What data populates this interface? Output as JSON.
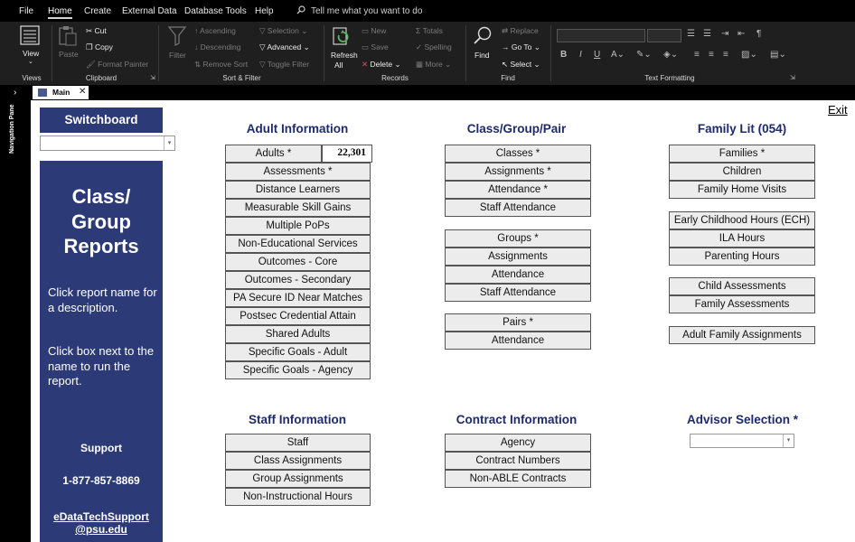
{
  "menu": {
    "tabs": [
      "File",
      "Home",
      "Create",
      "External Data",
      "Database Tools",
      "Help"
    ],
    "active": "Home",
    "tell_me": "Tell me what you want to do"
  },
  "ribbon": {
    "views": {
      "view_label": "View",
      "group_label": "Views"
    },
    "clipboard": {
      "paste_label": "Paste",
      "cut_label": "Cut",
      "copy_label": "Copy",
      "format_painter_label": "Format Painter",
      "group_label": "Clipboard"
    },
    "sort_filter": {
      "filter_label": "Filter",
      "ascending_label": "Ascending",
      "descending_label": "Descending",
      "remove_sort_label": "Remove Sort",
      "selection_label": "Selection",
      "advanced_label": "Advanced",
      "toggle_filter_label": "Toggle Filter",
      "group_label": "Sort & Filter"
    },
    "records": {
      "refresh_label": "Refresh",
      "refresh_all_label": "All",
      "new_label": "New",
      "save_label": "Save",
      "delete_label": "Delete",
      "totals_label": "Totals",
      "spelling_label": "Spelling",
      "more_label": "More",
      "group_label": "Records"
    },
    "find": {
      "find_label": "Find",
      "replace_label": "Replace",
      "goto_label": "Go To",
      "select_label": "Select",
      "group_label": "Find"
    },
    "text_formatting": {
      "group_label": "Text Formatting",
      "bold": "B",
      "italic": "I",
      "underline": "U"
    }
  },
  "nav_pane": {
    "label": "Navigation Pane"
  },
  "document_tab": {
    "label": "Main"
  },
  "form": {
    "exit_label": "Exit",
    "switchboard": {
      "title": "Switchboard",
      "combo_value": ""
    },
    "side_panel": {
      "title": "Class/ Group Reports",
      "instruction_1": "Click report name for a description.",
      "instruction_2": "Click box next to the name to run the report.",
      "support_title": "Support",
      "support_phone": "1-877-857-8869",
      "support_email": "eDataTechSupport @psu.edu"
    },
    "adult_information": {
      "title": "Adult Information",
      "adults_count": "22,301",
      "buttons": [
        "Adults *",
        "Assessments *",
        "Distance Learners",
        "Measurable Skill Gains",
        "Multiple PoPs",
        "Non-Educational Services",
        "Outcomes - Core",
        "Outcomes - Secondary",
        "PA Secure ID Near Matches",
        "Postsec Credential Attain",
        "Shared Adults",
        "Specific Goals - Adult",
        "Specific Goals - Agency"
      ]
    },
    "class_group_pair": {
      "title": "Class/Group/Pair",
      "class_buttons": [
        "Classes *",
        "Assignments *",
        "Attendance *",
        "Staff Attendance"
      ],
      "group_buttons": [
        "Groups *",
        "Assignments",
        "Attendance",
        "Staff Attendance"
      ],
      "pair_buttons": [
        "Pairs *",
        "Attendance"
      ]
    },
    "family_lit": {
      "title": "Family Lit (054)",
      "family_buttons": [
        "Families *",
        "Children",
        "Family Home Visits"
      ],
      "hours_buttons": [
        "Early Childhood Hours (ECH)",
        "ILA Hours",
        "Parenting Hours"
      ],
      "assessment_buttons": [
        "Child Assessments",
        "Family Assessments"
      ],
      "assignment_buttons": [
        "Adult Family Assignments"
      ]
    },
    "staff_information": {
      "title": "Staff  Information",
      "buttons": [
        "Staff",
        "Class Assignments",
        "Group Assignments",
        "Non-Instructional Hours"
      ]
    },
    "contract_information": {
      "title": "Contract  Information",
      "buttons": [
        "Agency",
        "Contract Numbers",
        "Non-ABLE Contracts"
      ]
    },
    "advisor_selection": {
      "title": "Advisor Selection *",
      "combo_value": ""
    }
  }
}
